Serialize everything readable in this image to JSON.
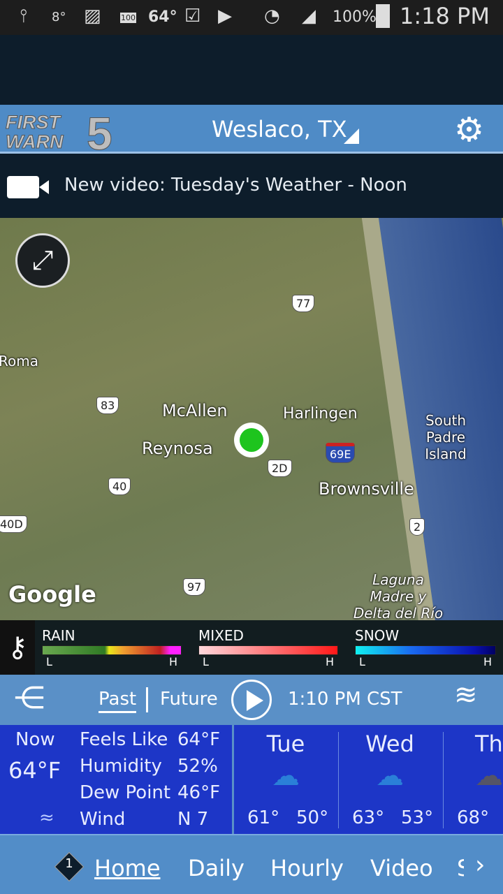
{
  "status_bar": {
    "weather_small": "8°",
    "battery_badge": "100",
    "temp": "64°",
    "battery": "100%",
    "time": "1:18 PM"
  },
  "header": {
    "logo": "FIRST WARN 5",
    "location": "Weslaco, TX",
    "settings_icon": "gear-icon"
  },
  "banner": {
    "text": "New video: Tuesday's Weather - Noon",
    "icon": "video-camera-icon"
  },
  "map": {
    "labels": [
      "Roma",
      "McAllen",
      "Reynosa",
      "Harlingen",
      "South Padre Island",
      "Brownsville",
      "Laguna Madre y Delta del Río Bravo"
    ],
    "shields": [
      "77",
      "83",
      "40",
      "40D",
      "2D",
      "69E",
      "2",
      "97"
    ],
    "attribution": "Google",
    "pin_color": "#1ec41e"
  },
  "legend": {
    "rain": "RAIN",
    "mixed": "MIXED",
    "snow": "SNOW",
    "low": "L",
    "high": "H"
  },
  "controls": {
    "past": "Past",
    "future": "Future",
    "time": "1:10 PM CST",
    "active": "Past"
  },
  "current": {
    "now": "Now",
    "temp": "64°F",
    "feels_like_label": "Feels Like",
    "feels_like": "64°F",
    "humidity_label": "Humidity",
    "humidity": "52%",
    "dew_point_label": "Dew Point",
    "dew_point": "46°F",
    "wind_label": "Wind",
    "wind": "N 7"
  },
  "forecast": [
    {
      "day": "Tue",
      "high": "61°",
      "low": "50°",
      "icon": "rain-icon"
    },
    {
      "day": "Wed",
      "high": "63°",
      "low": "53°",
      "icon": "rain-icon"
    },
    {
      "day": "Th",
      "high": "68°",
      "icon": "partly-cloudy-icon"
    }
  ],
  "nav": {
    "badge": "1",
    "items": [
      "Home",
      "Daily",
      "Hourly",
      "Video",
      "S"
    ],
    "active": "Home"
  }
}
